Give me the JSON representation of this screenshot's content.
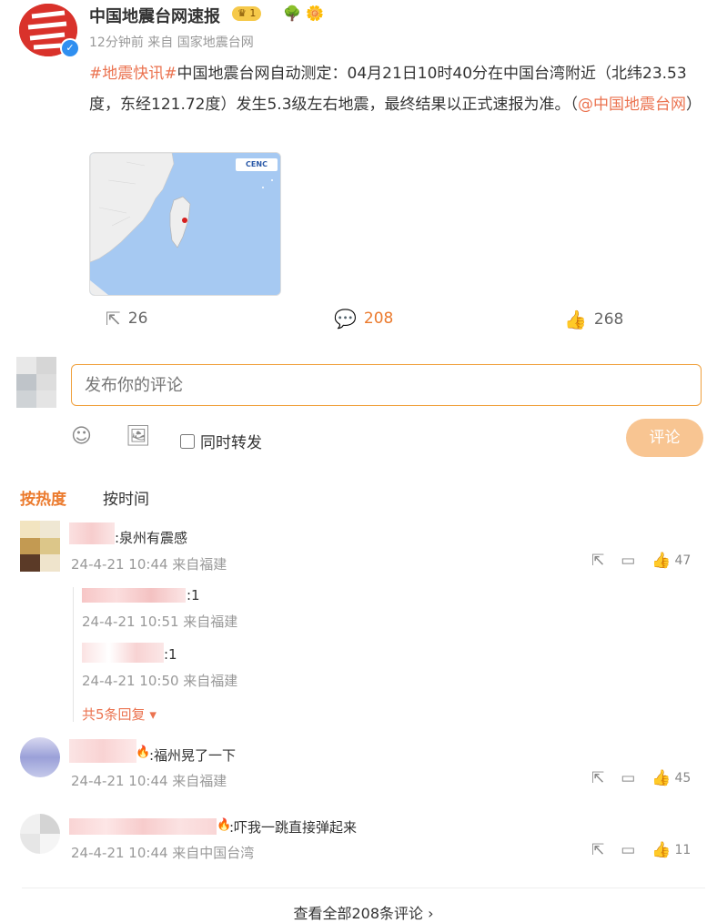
{
  "post": {
    "author": "中国地震台网速报",
    "vip_level": "1",
    "time": "12分钟前",
    "source_prefix": "来自",
    "source": "国家地震台网",
    "hashtag": "#地震快讯#",
    "body": "中国地震台网自动测定：04月21日10时40分在中国台湾附近（北纬23.53度，东经121.72度）发生5.3级左右地震，最终结果以正式速报为准。（",
    "mention": "@中国地震台网",
    "body_end": "）",
    "map_logo": "CENC",
    "actions": {
      "repost": "26",
      "comment": "208",
      "like": "268"
    }
  },
  "composer": {
    "placeholder": "发布你的评论",
    "repost_label": "同时转发",
    "submit_label": "评论"
  },
  "sort_tabs": {
    "hot": "按热度",
    "time": "按时间"
  },
  "comments": [
    {
      "text": ":泉州有震感",
      "time": "24-4-21 10:44 来自福建",
      "like": "47",
      "replies": [
        {
          "text": ":1",
          "time": "24-4-21 10:51 来自福建"
        },
        {
          "text": ":1",
          "time": "24-4-21 10:50 来自福建"
        }
      ],
      "more": "共5条回复"
    },
    {
      "text": ":福州晃了一下",
      "time": "24-4-21 10:44 来自福建",
      "like": "45"
    },
    {
      "text": ":吓我一跳直接弹起来",
      "time": "24-4-21 10:44 来自中国台湾",
      "like": "11"
    }
  ],
  "view_all": "查看全部208条评论",
  "colors": {
    "accent": "#eb7a2d",
    "link": "#eb7350",
    "button": "#f8c592"
  }
}
